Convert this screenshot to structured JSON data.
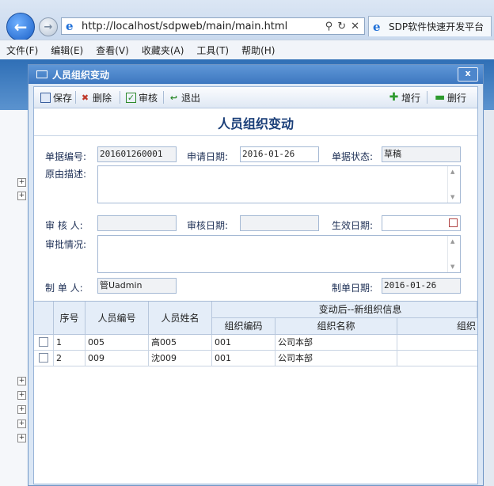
{
  "browser": {
    "url": "http://localhost/sdpweb/main/main.html",
    "tab_title": "SDP软件快速开发平台",
    "menu": [
      "文件(F)",
      "编辑(E)",
      "查看(V)",
      "收藏夹(A)",
      "工具(T)",
      "帮助(H)"
    ]
  },
  "dialog": {
    "title": "人员组织变动",
    "close_label": "x",
    "toolbar": {
      "save": "保存",
      "delete": "删除",
      "audit": "审核",
      "exit": "退出",
      "add_row": "增行",
      "delete_row": "删行"
    },
    "form_title": "人员组织变动",
    "fields": {
      "doc_no_label": "单据编号:",
      "doc_no": "201601260001",
      "apply_date_label": "申请日期:",
      "apply_date": "2016-01-26",
      "status_label": "单据状态:",
      "status": "草稿",
      "reason_label": "原由描述:",
      "reviewer_label": "审 核 人:",
      "review_date_label": "审核日期:",
      "effective_date_label": "生效日期:",
      "approval_label": "审批情况:",
      "creator_label": "制 单 人:",
      "creator": "管Uadmin",
      "create_date_label": "制单日期:",
      "create_date": "2016-01-26"
    },
    "grid": {
      "headers": {
        "seq": "序号",
        "emp_code": "人员编号",
        "emp_name": "人员姓名",
        "group": "变动后--新组织信息",
        "org_code": "组织编码",
        "org_name": "组织名称",
        "org_extra": "组织"
      },
      "rows": [
        {
          "seq": "1",
          "emp_code": "005",
          "emp_name": "高005",
          "org_code": "001",
          "org_name": "公司本部"
        },
        {
          "seq": "2",
          "emp_code": "009",
          "emp_name": "沈009",
          "org_code": "001",
          "org_name": "公司本部"
        }
      ]
    }
  }
}
